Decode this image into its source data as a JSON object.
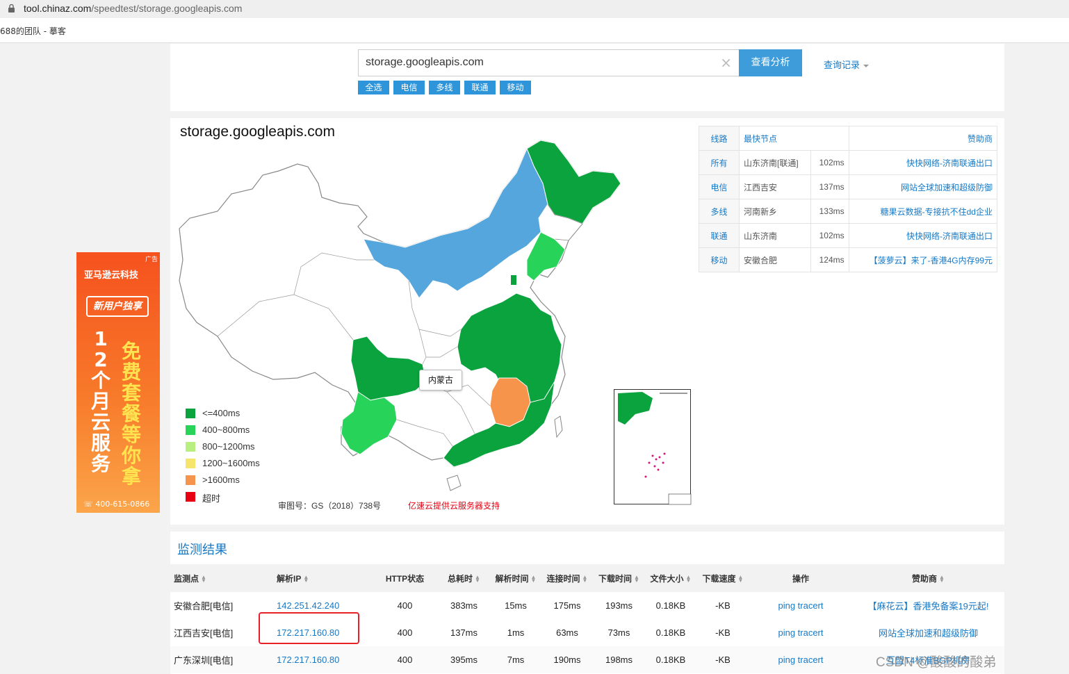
{
  "browser": {
    "url_host": "tool.chinaz.com",
    "url_path": "/speedtest/storage.googleapis.com",
    "bookmark": "688的团队 - 摹客"
  },
  "search": {
    "value": "storage.googleapis.com",
    "clear_icon": "×",
    "analyze_label": "查看分析",
    "history_label": "查询记录",
    "filters": [
      "全选",
      "电信",
      "多线",
      "联通",
      "移动"
    ]
  },
  "map": {
    "title": "storage.googleapis.com",
    "tooltip": "内蒙古",
    "legend": [
      {
        "label": "<=400ms",
        "color": "#0aa33e"
      },
      {
        "label": "400~800ms",
        "color": "#28d35a"
      },
      {
        "label": "800~1200ms",
        "color": "#b9ef80"
      },
      {
        "label": "1200~1600ms",
        "color": "#f5e56b"
      },
      {
        "label": ">1600ms",
        "color": "#f5944a"
      },
      {
        "label": "超时",
        "color": "#e60012"
      }
    ],
    "approval": "审图号：GS（2018）738号",
    "sponsor": "亿速云提供云服务器支持",
    "colors": {
      "fast": "#0aa33e",
      "mid": "#28d35a",
      "blue": "#55a6dc",
      "orange": "#f5944a"
    }
  },
  "fastest": {
    "headers": {
      "line": "线路",
      "node": "最快节点",
      "sponsor": "赞助商"
    },
    "rows": [
      {
        "line": "所有",
        "node": "山东济南[联通]",
        "ms": "102ms",
        "sponsor": "快快网络-济南联通出口"
      },
      {
        "line": "电信",
        "node": "江西吉安",
        "ms": "137ms",
        "sponsor": "网站全球加速和超级防御"
      },
      {
        "line": "多线",
        "node": "河南新乡",
        "ms": "133ms",
        "sponsor": "糖果云数据-专接抗不住dd企业"
      },
      {
        "line": "联通",
        "node": "山东济南",
        "ms": "102ms",
        "sponsor": "快快网络-济南联通出口"
      },
      {
        "line": "移动",
        "node": "安徽合肥",
        "ms": "124ms",
        "sponsor": "【菠萝云】来了-香港4G内存99元"
      }
    ]
  },
  "ad": {
    "tag": "广告",
    "brand": "亚马逊云科技",
    "bubble": "新用户独享",
    "col1": "12个月云服务",
    "col2": "免费套餐等你拿",
    "phone": "400-615-0866"
  },
  "results": {
    "title": "监测结果",
    "headers": [
      "监测点",
      "解析IP",
      "HTTP状态",
      "总耗时",
      "解析时间",
      "连接时间",
      "下载时间",
      "文件大小",
      "下载速度",
      "操作",
      "赞助商"
    ],
    "rows": [
      {
        "point": "安徽合肥[电信]",
        "ip": "142.251.42.240",
        "status": "400",
        "total": "383ms",
        "resolve": "15ms",
        "connect": "175ms",
        "download": "193ms",
        "size": "0.18KB",
        "speed": "-KB",
        "ops": "ping tracert",
        "sponsor": "【麻花云】香港免备案19元起!"
      },
      {
        "point": "江西吉安[电信]",
        "ip": "172.217.160.80",
        "status": "400",
        "total": "137ms",
        "resolve": "1ms",
        "connect": "63ms",
        "download": "73ms",
        "size": "0.18KB",
        "speed": "-KB",
        "ops": "ping tracert",
        "sponsor": "网站全球加速和超级防御"
      },
      {
        "point": "广东深圳[电信]",
        "ip": "172.217.160.80",
        "status": "400",
        "total": "395ms",
        "resolve": "7ms",
        "connect": "190ms",
        "download": "198ms",
        "size": "0.18KB",
        "speed": "-KB",
        "ops": "ping tracert",
        "sponsor": "互盟T4标准BGP机房"
      }
    ]
  },
  "watermark": "CSDN @酸酸的酸弟"
}
